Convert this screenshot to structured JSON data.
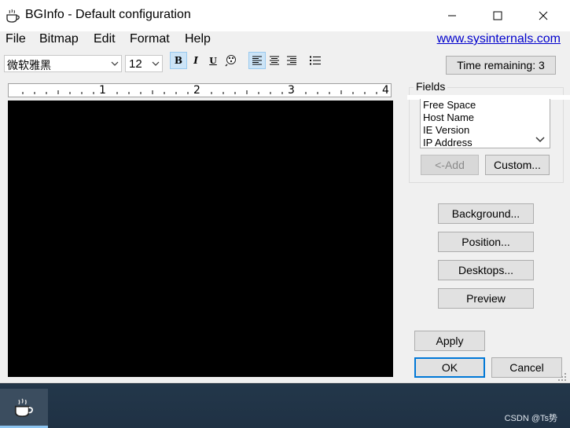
{
  "window": {
    "title": "BGInfo - Default configuration",
    "icon": "coffee-cup-icon"
  },
  "menu": {
    "items": [
      "File",
      "Bitmap",
      "Edit",
      "Format",
      "Help"
    ],
    "link": "www.sysinternals.com"
  },
  "toolbar": {
    "font_name": "微软雅黑",
    "font_size": "12",
    "bold": "B",
    "italic": "I",
    "underline": "U",
    "active_buttons": [
      "bold",
      "align-left"
    ],
    "time_remaining": "Time remaining: 3"
  },
  "ruler": {
    "numbers": [
      "1",
      "2",
      "3",
      "4"
    ]
  },
  "fields": {
    "label": "Fields",
    "items": [
      "Free Space",
      "Host Name",
      "IE Version",
      "IP Address"
    ],
    "add_label": "<-Add",
    "custom_label": "Custom..."
  },
  "buttons": {
    "background": "Background...",
    "position": "Position...",
    "desktops": "Desktops...",
    "preview": "Preview",
    "apply": "Apply",
    "ok": "OK",
    "cancel": "Cancel"
  },
  "taskbar": {
    "watermark": "CSDN @Ts势"
  },
  "colors": {
    "editor_bg": "#000000",
    "link": "#0000cc",
    "focus_border": "#0078d7",
    "taskbar": "#1f3144"
  }
}
